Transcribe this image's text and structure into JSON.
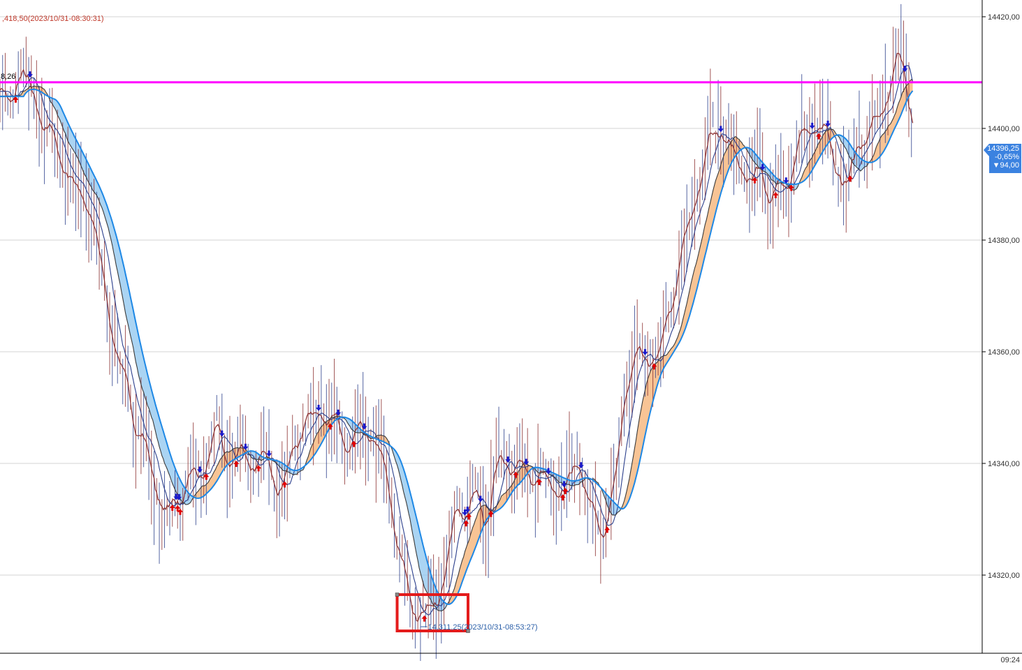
{
  "chart_data": {
    "type": "line",
    "y_axis": {
      "range": [
        14306,
        14423
      ],
      "ticks": [
        14420,
        14400,
        14380,
        14360,
        14340,
        14320
      ],
      "tick_labels": [
        "14420,00",
        "14400,00",
        "14380,00",
        "14360,00",
        "14340,00",
        "14320,00"
      ],
      "position": "right",
      "grid": true
    },
    "x_axis": {
      "tick_labels": [
        "09:24"
      ]
    },
    "high_marker": {
      "value": 14418.5,
      "label": ",418,50(2023/10/31-08:30:31)"
    },
    "low_marker": {
      "value": 14311.25,
      "label": "14,311,25(2023/10/31-08:53:27)"
    },
    "horizontal_line": {
      "value": 14408.26,
      "label": "8,26",
      "color": "#ff00ff"
    },
    "current_price": {
      "value": 14396.25,
      "labels": [
        "14396,25",
        "-0,65%",
        "▼94,00"
      ],
      "color": "#3b82e0"
    },
    "highlight_box": {
      "x_range": [
        0.409,
        0.482
      ],
      "y_range": [
        14310,
        14316.5
      ],
      "color": "#e41b1b"
    },
    "price_keypoints": [
      [
        0.0,
        14408
      ],
      [
        0.012,
        14402
      ],
      [
        0.02,
        14412
      ],
      [
        0.035,
        14404
      ],
      [
        0.05,
        14400
      ],
      [
        0.065,
        14394
      ],
      [
        0.08,
        14389
      ],
      [
        0.095,
        14384
      ],
      [
        0.11,
        14370
      ],
      [
        0.125,
        14356
      ],
      [
        0.14,
        14348
      ],
      [
        0.155,
        14340
      ],
      [
        0.168,
        14331
      ],
      [
        0.18,
        14333
      ],
      [
        0.195,
        14336
      ],
      [
        0.21,
        14338
      ],
      [
        0.222,
        14346
      ],
      [
        0.235,
        14340
      ],
      [
        0.25,
        14342
      ],
      [
        0.265,
        14340
      ],
      [
        0.28,
        14339
      ],
      [
        0.292,
        14336
      ],
      [
        0.305,
        14344
      ],
      [
        0.32,
        14349
      ],
      [
        0.335,
        14350
      ],
      [
        0.35,
        14345
      ],
      [
        0.362,
        14342
      ],
      [
        0.375,
        14346
      ],
      [
        0.388,
        14343
      ],
      [
        0.4,
        14336
      ],
      [
        0.41,
        14325
      ],
      [
        0.42,
        14317
      ],
      [
        0.432,
        14313
      ],
      [
        0.445,
        14314
      ],
      [
        0.455,
        14316
      ],
      [
        0.462,
        14324
      ],
      [
        0.47,
        14333
      ],
      [
        0.48,
        14330
      ],
      [
        0.49,
        14334
      ],
      [
        0.5,
        14328
      ],
      [
        0.51,
        14338
      ],
      [
        0.52,
        14342
      ],
      [
        0.532,
        14340
      ],
      [
        0.545,
        14336
      ],
      [
        0.558,
        14339
      ],
      [
        0.57,
        14337
      ],
      [
        0.582,
        14334
      ],
      [
        0.595,
        14342
      ],
      [
        0.608,
        14331
      ],
      [
        0.62,
        14326
      ],
      [
        0.632,
        14334
      ],
      [
        0.642,
        14350
      ],
      [
        0.655,
        14360
      ],
      [
        0.668,
        14358
      ],
      [
        0.68,
        14360
      ],
      [
        0.69,
        14368
      ],
      [
        0.7,
        14377
      ],
      [
        0.712,
        14385
      ],
      [
        0.722,
        14390
      ],
      [
        0.732,
        14398
      ],
      [
        0.742,
        14400
      ],
      [
        0.752,
        14396
      ],
      [
        0.762,
        14393
      ],
      [
        0.772,
        14390
      ],
      [
        0.782,
        14392
      ],
      [
        0.792,
        14388
      ],
      [
        0.802,
        14390
      ],
      [
        0.812,
        14390
      ],
      [
        0.822,
        14396
      ],
      [
        0.832,
        14400
      ],
      [
        0.842,
        14402
      ],
      [
        0.852,
        14398
      ],
      [
        0.862,
        14393
      ],
      [
        0.872,
        14389
      ],
      [
        0.882,
        14396
      ],
      [
        0.892,
        14398
      ],
      [
        0.902,
        14401
      ],
      [
        0.912,
        14405
      ],
      [
        0.918,
        14408
      ],
      [
        0.926,
        14415
      ],
      [
        0.934,
        14408
      ],
      [
        0.94,
        14397
      ]
    ],
    "series": [
      {
        "name": "",
        "color": "#8b2e2e"
      },
      {
        "name": "",
        "color": "#2b3f8c"
      },
      {
        "name": "",
        "color": "#3a3a3a"
      },
      {
        "name": "",
        "color": "#1e88e5"
      }
    ],
    "cloud_colors": {
      "up": "#f6b072",
      "down": "#8ec5ef"
    },
    "signal_colors": {
      "buy": "#e00000",
      "sell": "#1a1acc"
    }
  }
}
